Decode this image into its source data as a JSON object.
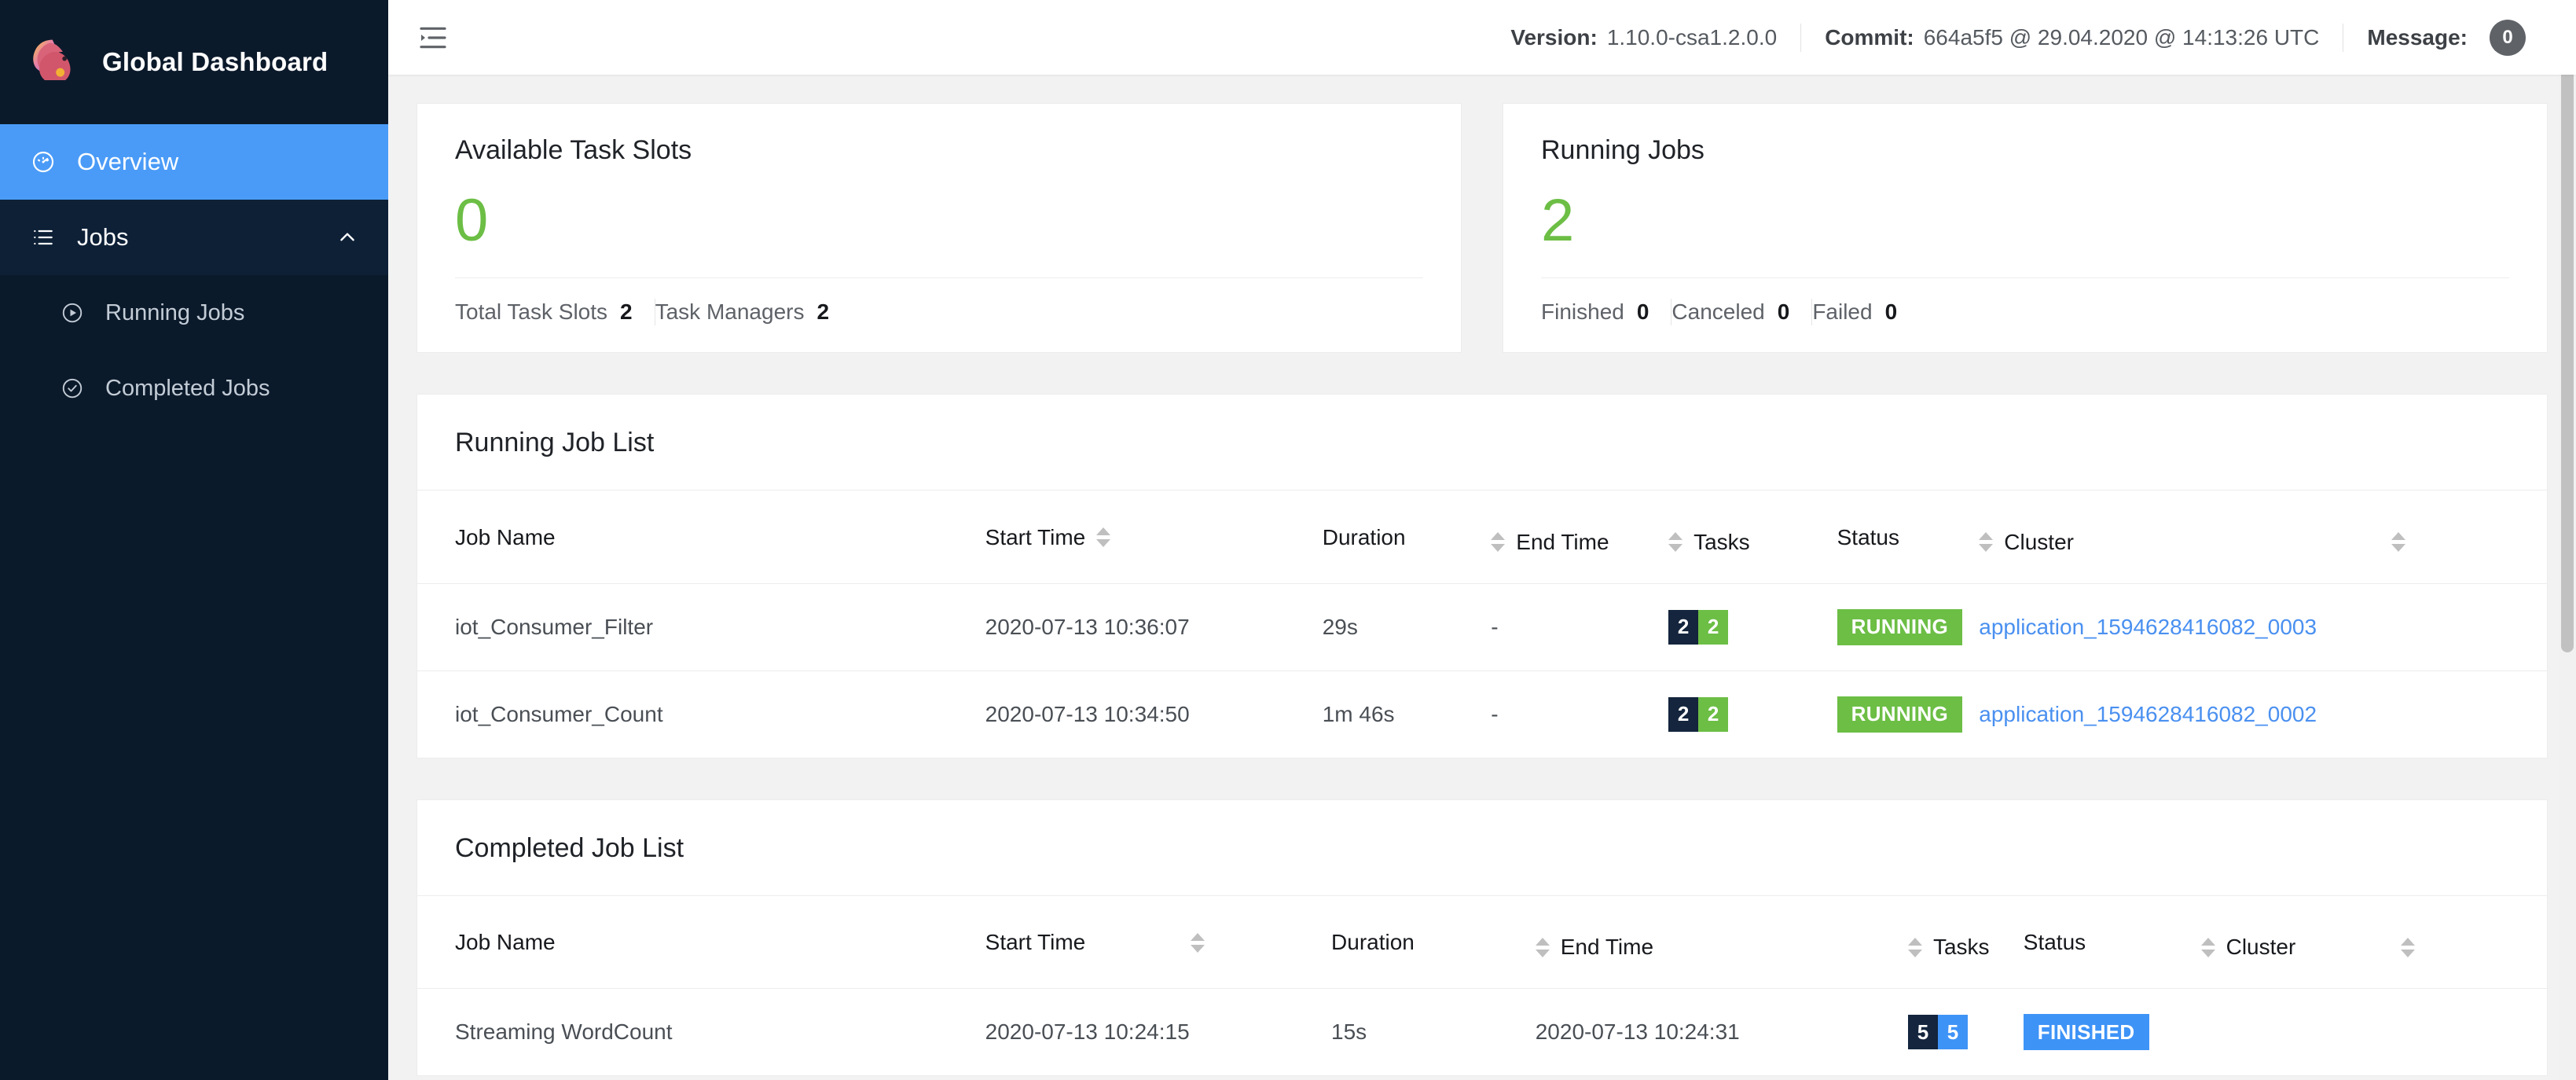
{
  "sidebar": {
    "brand": {
      "title": "Global Dashboard",
      "logo_icon": "flink-squirrel-logo"
    },
    "items": [
      {
        "label": "Overview",
        "icon": "dashboard-gauge-icon",
        "active": true
      },
      {
        "label": "Jobs",
        "icon": "list-icon",
        "active": false,
        "expanded": true,
        "caret": "chevron-up-icon"
      }
    ],
    "sub_items": [
      {
        "label": "Running Jobs",
        "icon": "play-circle-icon"
      },
      {
        "label": "Completed Jobs",
        "icon": "check-circle-icon"
      }
    ]
  },
  "topbar": {
    "fold_icon": "menu-fold-icon",
    "version_label": "Version:",
    "version_value": "1.10.0-csa1.2.0.0",
    "commit_label": "Commit:",
    "commit_value": "664a5f5 @ 29.04.2020 @ 14:13:26 UTC",
    "message_label": "Message:",
    "message_count": "0"
  },
  "cards": [
    {
      "title": "Available Task Slots",
      "value": "0",
      "footer": [
        {
          "label": "Total Task Slots",
          "value": "2"
        },
        {
          "label": "Task Managers",
          "value": "2"
        }
      ]
    },
    {
      "title": "Running Jobs",
      "value": "2",
      "footer": [
        {
          "label": "Finished",
          "value": "0"
        },
        {
          "label": "Canceled",
          "value": "0"
        },
        {
          "label": "Failed",
          "value": "0"
        }
      ]
    }
  ],
  "running_panel": {
    "title": "Running Job List",
    "columns": {
      "job_name": "Job Name",
      "start_time": "Start Time",
      "duration": "Duration",
      "end_time": "End Time",
      "tasks": "Tasks",
      "status": "Status",
      "cluster": "Cluster"
    },
    "rows": [
      {
        "job_name": "iot_Consumer_Filter",
        "start_time": "2020-07-13 10:36:07",
        "duration": "29s",
        "end_time": "-",
        "tasks_left": "2",
        "tasks_right": "2",
        "status": "RUNNING",
        "cluster": "application_1594628416082_0003"
      },
      {
        "job_name": "iot_Consumer_Count",
        "start_time": "2020-07-13 10:34:50",
        "duration": "1m 46s",
        "end_time": "-",
        "tasks_left": "2",
        "tasks_right": "2",
        "status": "RUNNING",
        "cluster": "application_1594628416082_0002"
      }
    ]
  },
  "completed_panel": {
    "title": "Completed Job List",
    "columns": {
      "job_name": "Job Name",
      "start_time": "Start Time",
      "duration": "Duration",
      "end_time": "End Time",
      "tasks": "Tasks",
      "status": "Status",
      "cluster": "Cluster"
    },
    "rows": [
      {
        "job_name": "Streaming WordCount",
        "start_time": "2020-07-13 10:24:15",
        "duration": "15s",
        "end_time": "2020-07-13 10:24:31",
        "tasks_left": "5",
        "tasks_right": "5",
        "status": "FINISHED",
        "cluster": ""
      }
    ]
  },
  "colors": {
    "sidebar_bg": "#0b1a2b",
    "active_nav": "#4a9bf7",
    "green": "#6cbe45",
    "blue": "#3e93f7",
    "dark_badge": "#14253d",
    "link": "#4a90f0"
  }
}
